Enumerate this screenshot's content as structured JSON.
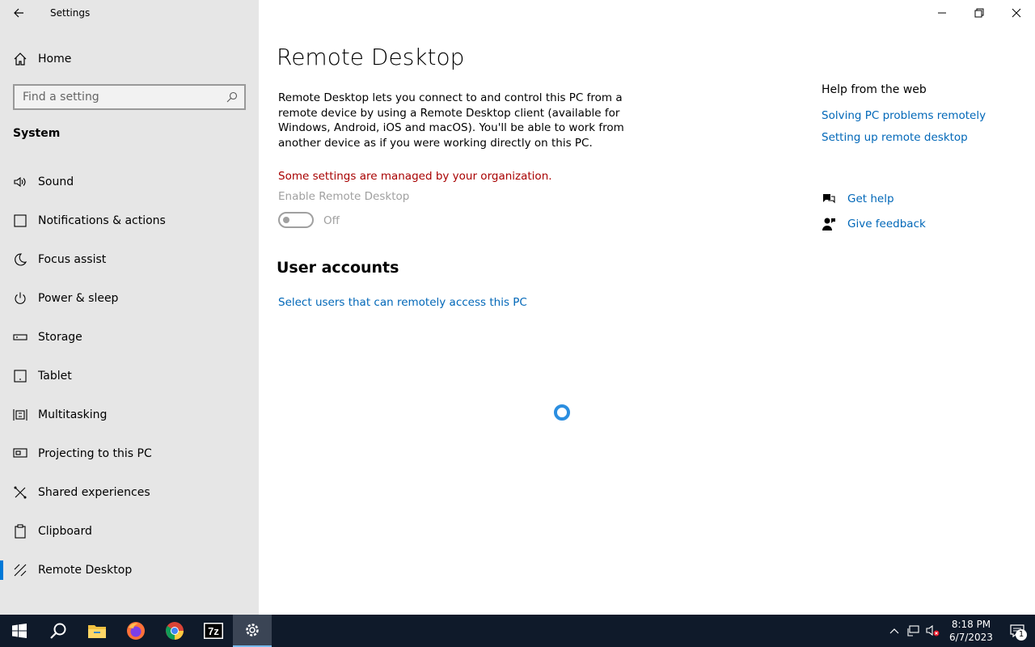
{
  "window": {
    "app_title": "Settings"
  },
  "sidebar": {
    "home_label": "Home",
    "search_placeholder": "Find a setting",
    "section_title": "System",
    "items": [
      {
        "label": "Sound",
        "icon": "speaker-icon"
      },
      {
        "label": "Notifications & actions",
        "icon": "notification-icon"
      },
      {
        "label": "Focus assist",
        "icon": "moon-icon"
      },
      {
        "label": "Power & sleep",
        "icon": "power-icon"
      },
      {
        "label": "Storage",
        "icon": "storage-icon"
      },
      {
        "label": "Tablet",
        "icon": "tablet-icon"
      },
      {
        "label": "Multitasking",
        "icon": "multitasking-icon"
      },
      {
        "label": "Projecting to this PC",
        "icon": "projector-icon"
      },
      {
        "label": "Shared experiences",
        "icon": "shared-icon"
      },
      {
        "label": "Clipboard",
        "icon": "clipboard-icon"
      },
      {
        "label": "Remote Desktop",
        "icon": "remote-desktop-icon",
        "active": true
      }
    ]
  },
  "main": {
    "title": "Remote Desktop",
    "description": "Remote Desktop lets you connect to and control this PC from a remote device by using a Remote Desktop client (available for Windows, Android, iOS and macOS). You'll be able to work from another device as if you were working directly on this PC.",
    "managed_warning": "Some settings are managed by your organization.",
    "toggle_label": "Enable Remote Desktop",
    "toggle_state": "Off",
    "user_accounts_title": "User accounts",
    "select_users_link": "Select users that can remotely access this PC"
  },
  "help": {
    "title": "Help from the web",
    "links": [
      "Solving PC problems remotely",
      "Setting up remote desktop"
    ],
    "get_help": "Get help",
    "give_feedback": "Give feedback"
  },
  "taskbar": {
    "time": "8:18 PM",
    "date": "6/7/2023",
    "notification_count": "1",
    "apps": [
      "start-icon",
      "search-icon",
      "file-explorer-icon",
      "firefox-icon",
      "chrome-icon",
      "7zip-icon",
      "settings-icon"
    ],
    "seven_zip_label": "7z"
  },
  "colors": {
    "accent": "#0078d7",
    "link": "#0067b8",
    "warning": "#a80000",
    "taskbar": "#0f1a2a"
  }
}
